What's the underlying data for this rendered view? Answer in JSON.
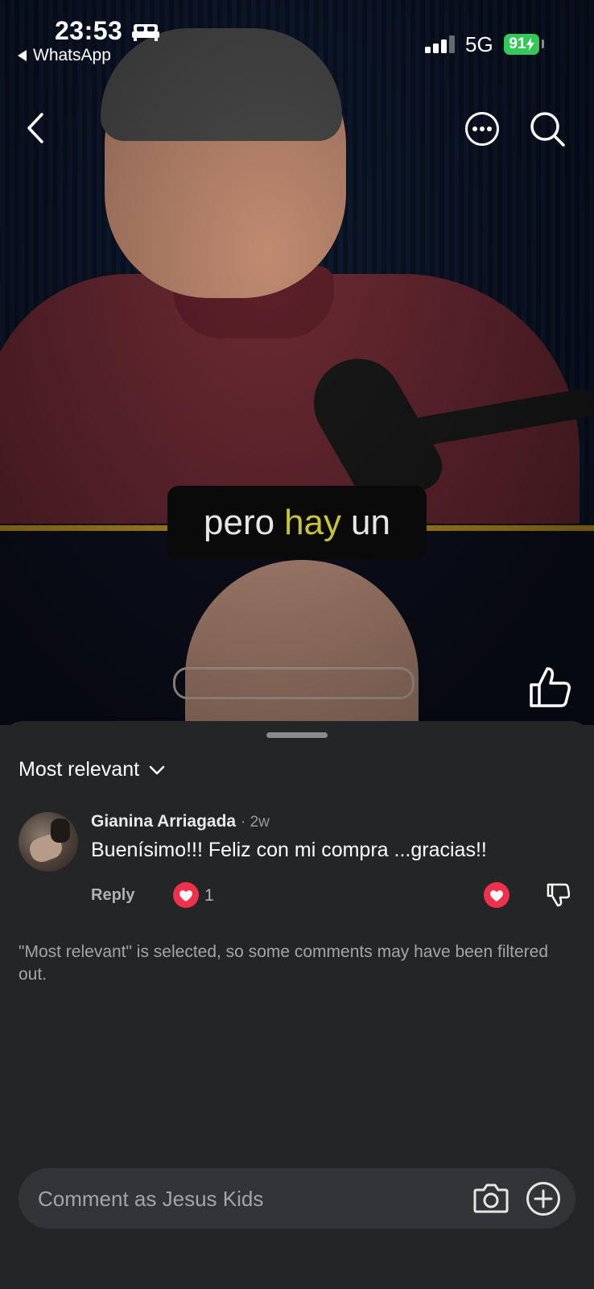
{
  "status_bar": {
    "time": "23:53",
    "back_app": "WhatsApp",
    "network": "5G",
    "battery": "91"
  },
  "video": {
    "caption_words": [
      "pero",
      "hay",
      "un"
    ]
  },
  "icons": {
    "back": "chevron-left-icon",
    "more": "more-options-icon",
    "search": "search-icon",
    "like": "thumbs-up-icon",
    "camera": "camera-icon",
    "add": "plus-circle-icon",
    "dislike": "thumbs-down-icon",
    "heart": "heart-icon"
  },
  "comments": {
    "sort_label": "Most relevant",
    "items": [
      {
        "author": "Gianina Arriagada",
        "time": "· 2w",
        "text": "Buenísimo!!! Feliz con mi compra ...gracias!!",
        "reply_label": "Reply",
        "reaction_count": "1"
      }
    ],
    "notice": "\"Most relevant\" is selected, so some comments may have been filtered out."
  },
  "composer": {
    "placeholder": "Comment as Jesus Kids"
  },
  "colors": {
    "sheet_bg": "#242527",
    "reaction_red": "#f0314d",
    "battery_green": "#35c759",
    "caption_highlight": "#c9c23c",
    "divider_gold": "#c89a1e"
  }
}
